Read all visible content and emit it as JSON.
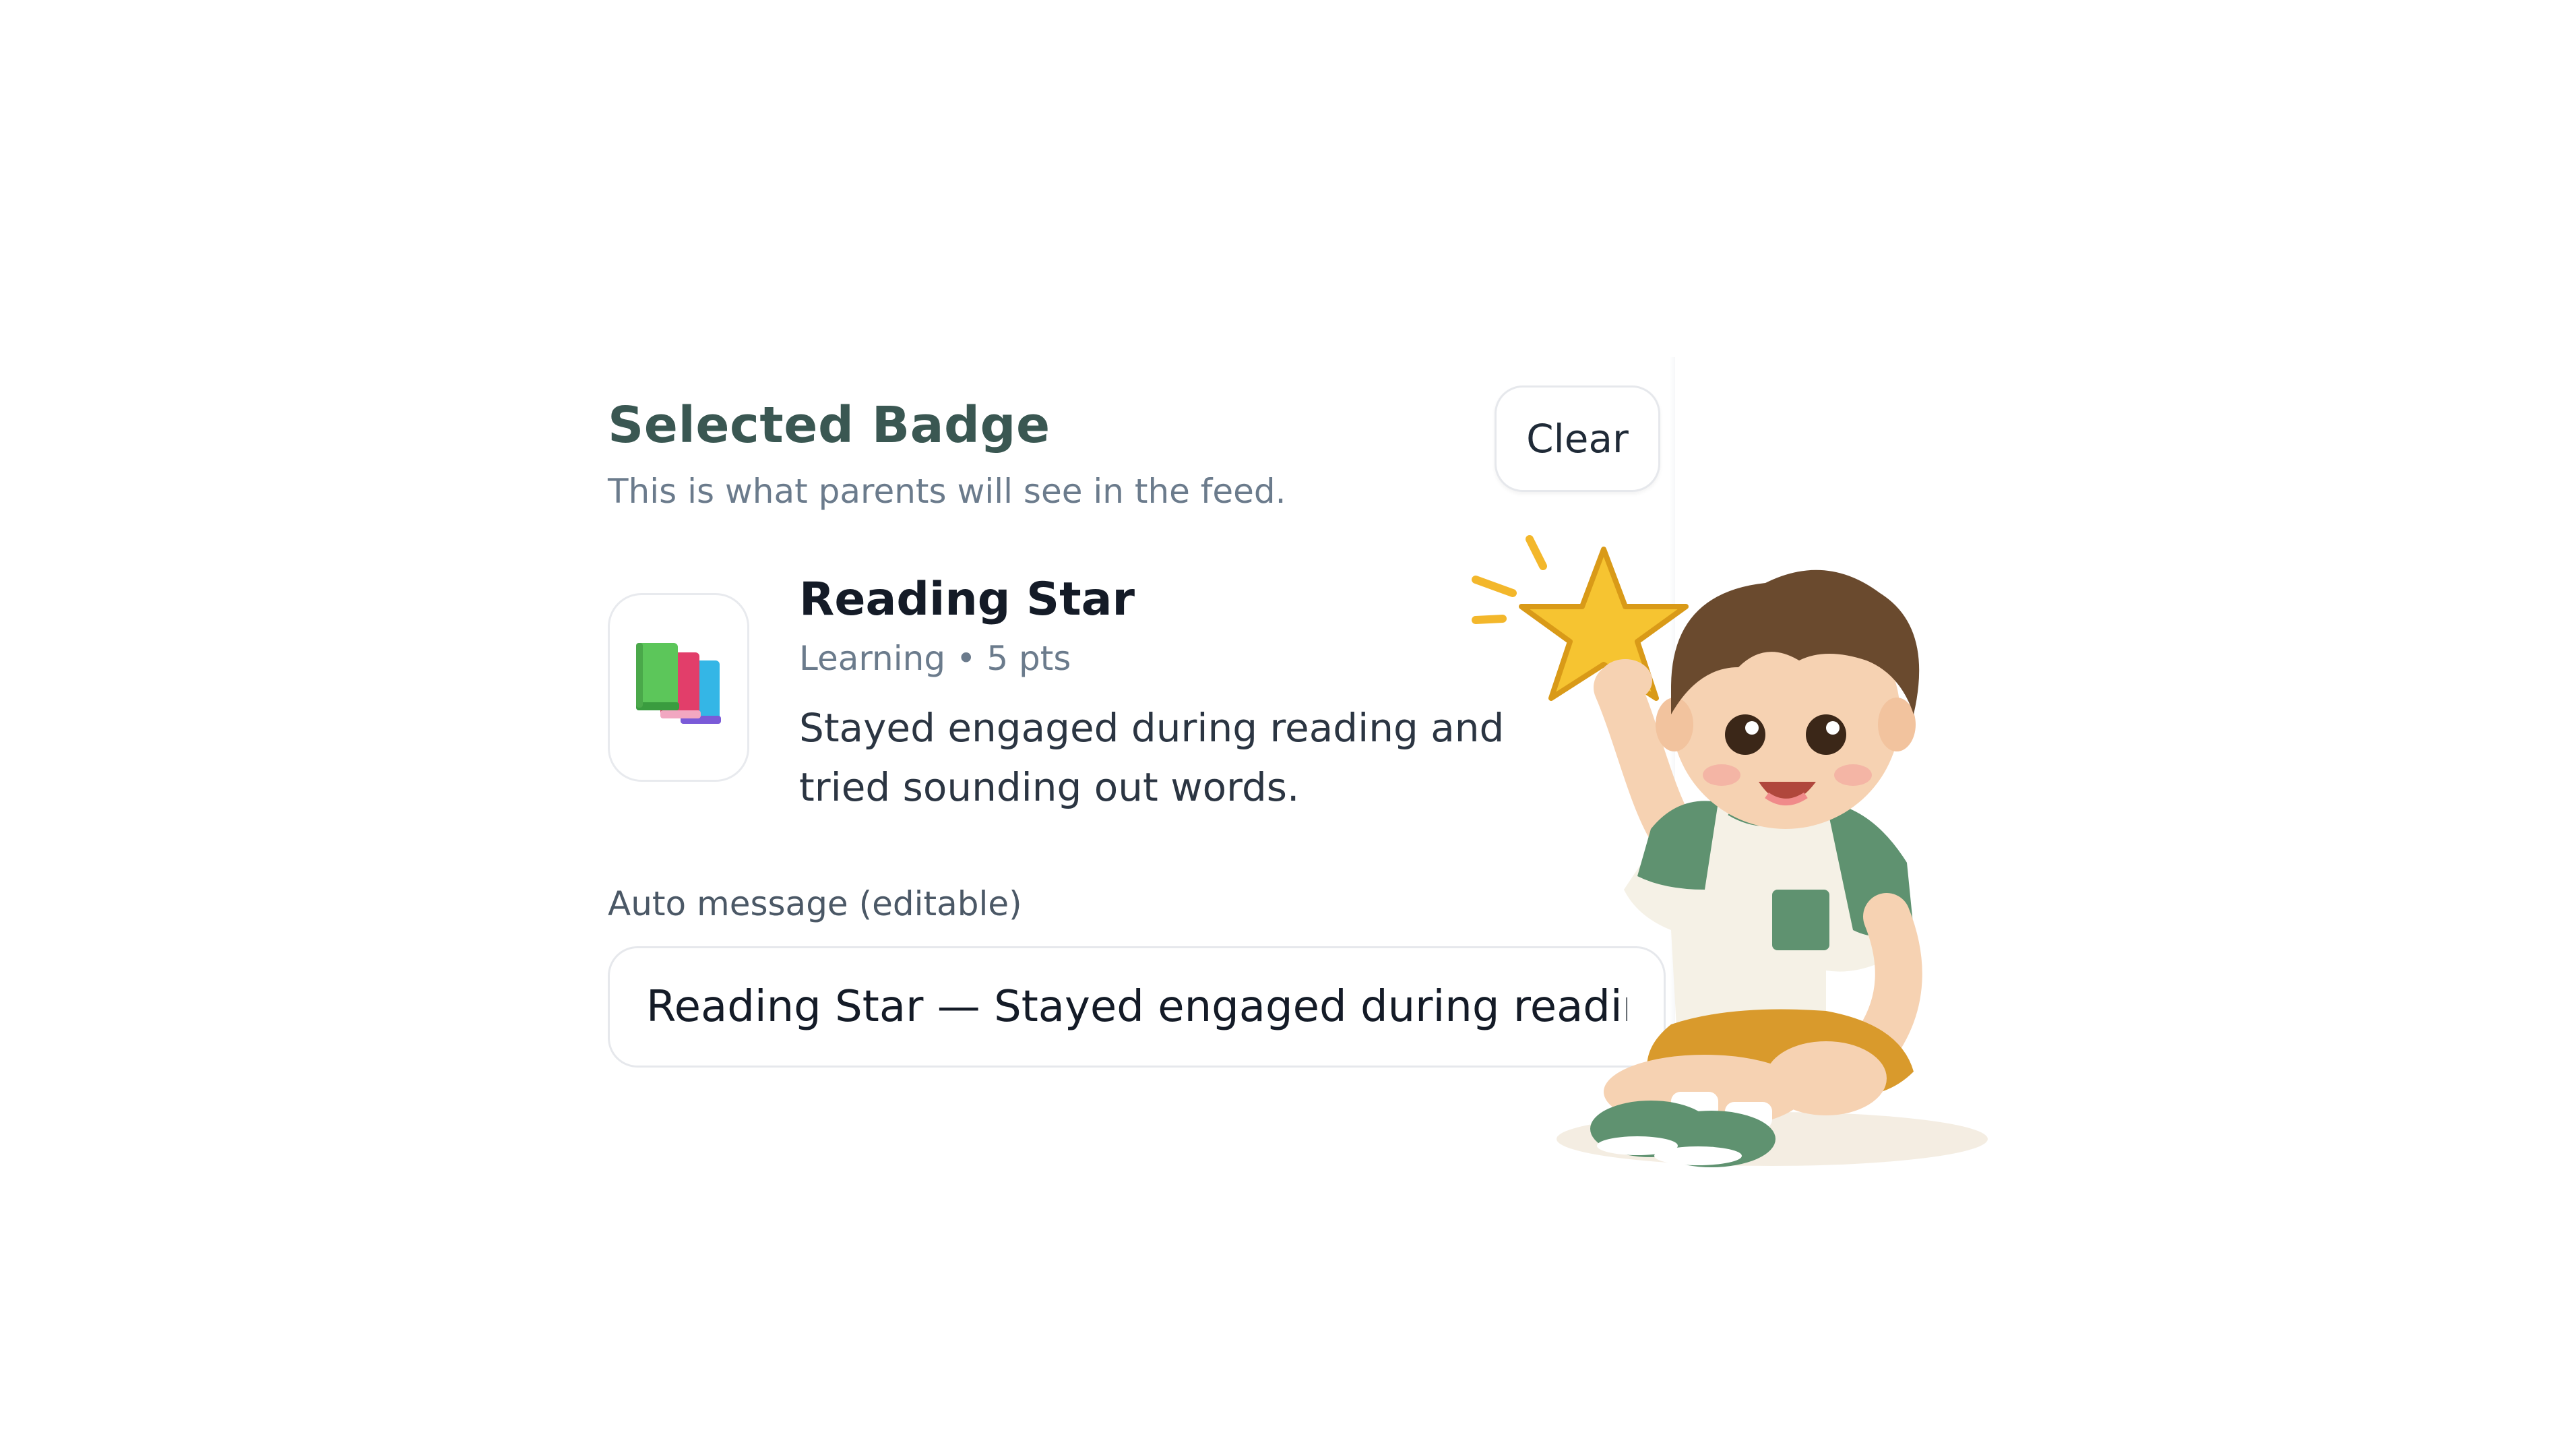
{
  "panel": {
    "title": "Selected Badge",
    "subtitle": "This is what parents will see in the feed.",
    "clear_label": "Clear"
  },
  "badge": {
    "icon": "books-icon",
    "name": "Reading Star",
    "meta": "Learning • 5 pts",
    "description": "Stayed engaged during reading and tried sounding out words."
  },
  "auto_message": {
    "label": "Auto message (editable)",
    "value": "Reading Star — Stayed engaged during reading and tried sounding out words."
  },
  "illustration": {
    "subject": "child-holding-star-illustration"
  },
  "colors": {
    "title": "#3a5752",
    "muted": "#6b7b8c",
    "star": "#f6c431"
  }
}
